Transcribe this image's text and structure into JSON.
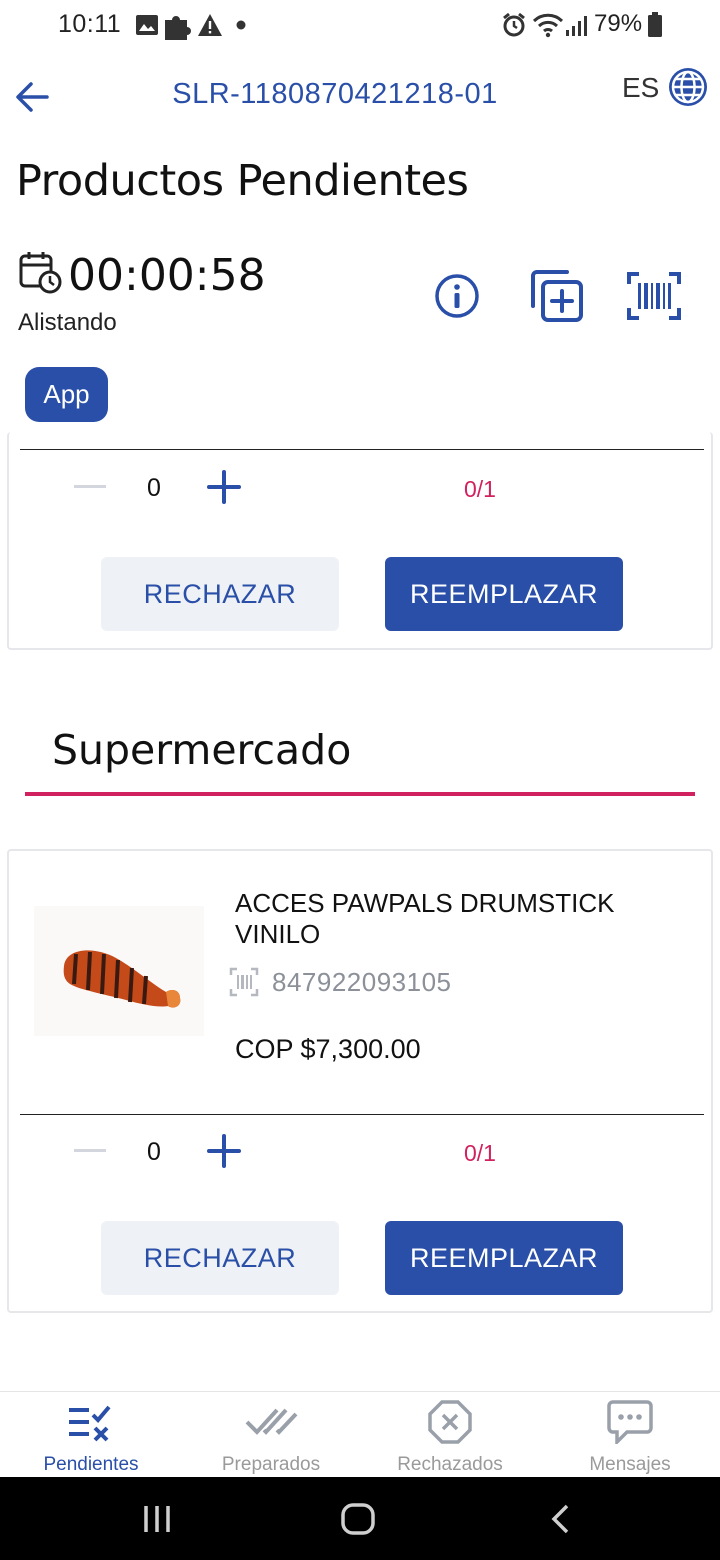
{
  "status_bar": {
    "time": "10:11",
    "battery": "79%",
    "icons": [
      "image-icon",
      "puzzle-icon",
      "warning-icon",
      "dot-icon",
      "alarm-icon",
      "wifi-icon",
      "signal-icon",
      "battery-icon"
    ]
  },
  "header": {
    "back_icon": "arrow-left-icon",
    "order_id": "SLR-1180870421218-01",
    "language": "ES",
    "language_icon": "globe-icon",
    "title": "Productos Pendientes"
  },
  "timer": {
    "icon": "calendar-clock-icon",
    "elapsed": "00:00:58",
    "status": "Alistando"
  },
  "toolbar": {
    "info_icon": "info-icon",
    "add_icon": "add-copy-icon",
    "scan_icon": "barcode-scan-icon"
  },
  "channel_chip": "App",
  "cards": [
    {
      "quantity": "0",
      "progress": "0/1",
      "reject_label": "RECHAZAR",
      "replace_label": "REEMPLAZAR"
    }
  ],
  "section": {
    "title": "Supermercado"
  },
  "product": {
    "name": "ACCES PAWPALS DRUMSTICK VINILO",
    "sku": "847922093105",
    "price": "COP $7,300.00",
    "quantity": "0",
    "progress": "0/1",
    "reject_label": "RECHAZAR",
    "replace_label": "REEMPLAZAR"
  },
  "bottom_nav": {
    "items": [
      {
        "label": "Pendientes",
        "icon": "list-check-icon",
        "active": true
      },
      {
        "label": "Preparados",
        "icon": "double-check-icon",
        "active": false
      },
      {
        "label": "Rechazados",
        "icon": "x-octagon-icon",
        "active": false
      },
      {
        "label": "Mensajes",
        "icon": "chat-icon",
        "active": false
      }
    ]
  },
  "colors": {
    "primary": "#2a4fa8",
    "accent": "#d1225f",
    "muted": "#9a9a9a"
  }
}
